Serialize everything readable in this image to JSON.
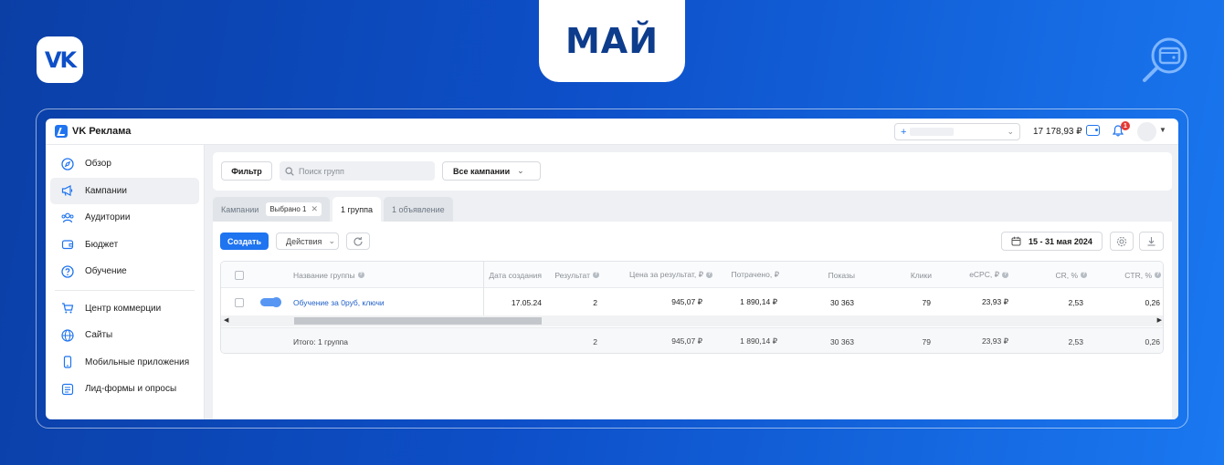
{
  "banner": {
    "logo_text": "VK",
    "month": "МАЙ",
    "accent_color": "#0d4fc8"
  },
  "app": {
    "brand": "VK Реклама",
    "balance": "17 178,93 ₽",
    "notifications_count": "1",
    "account_prefix": "+"
  },
  "sidebar": {
    "items": [
      {
        "label": "Обзор",
        "icon": "compass-icon"
      },
      {
        "label": "Кампании",
        "icon": "megaphone-icon",
        "active": true
      },
      {
        "label": "Аудитории",
        "icon": "audience-icon"
      },
      {
        "label": "Бюджет",
        "icon": "wallet-icon"
      },
      {
        "label": "Обучение",
        "icon": "help-icon"
      },
      {
        "label": "Центр коммерции",
        "icon": "cart-icon"
      },
      {
        "label": "Сайты",
        "icon": "globe-icon"
      },
      {
        "label": "Мобильные приложения",
        "icon": "phone-icon"
      },
      {
        "label": "Лид-формы и опросы",
        "icon": "form-icon"
      }
    ]
  },
  "filterbar": {
    "filter_label": "Фильтр",
    "search_placeholder": "Поиск групп",
    "campaign_select": "Все кампании"
  },
  "tabs": {
    "campaigns": "Кампании",
    "selected_chip": "Выбрано 1",
    "groups": "1 группа",
    "ads": "1 объявление"
  },
  "toolbar": {
    "create": "Создать",
    "actions": "Действия",
    "date_range": "15 - 31 мая 2024"
  },
  "table": {
    "columns": {
      "name": "Название группы",
      "created": "Дата создания",
      "result": "Результат",
      "cost_per_result": "Цена за результат, ₽",
      "spent": "Потрачено, ₽",
      "impressions": "Показы",
      "clicks": "Клики",
      "ecpc": "eCPC, ₽",
      "cr": "CR, %",
      "ctr": "CTR, %"
    },
    "row": {
      "name": "Обучение за 0руб, ключи",
      "created": "17.05.24",
      "result": "2",
      "cost_per_result": "945,07 ₽",
      "spent": "1 890,14 ₽",
      "impressions": "30 363",
      "clicks": "79",
      "ecpc": "23,93 ₽",
      "cr": "2,53",
      "ctr": "0,26",
      "enabled": true
    },
    "total": {
      "label": "Итого: 1 группа",
      "result": "2",
      "cost_per_result": "945,07 ₽",
      "spent": "1 890,14 ₽",
      "impressions": "30 363",
      "clicks": "79",
      "ecpc": "23,93 ₽",
      "cr": "2,53",
      "ctr": "0,26"
    }
  }
}
